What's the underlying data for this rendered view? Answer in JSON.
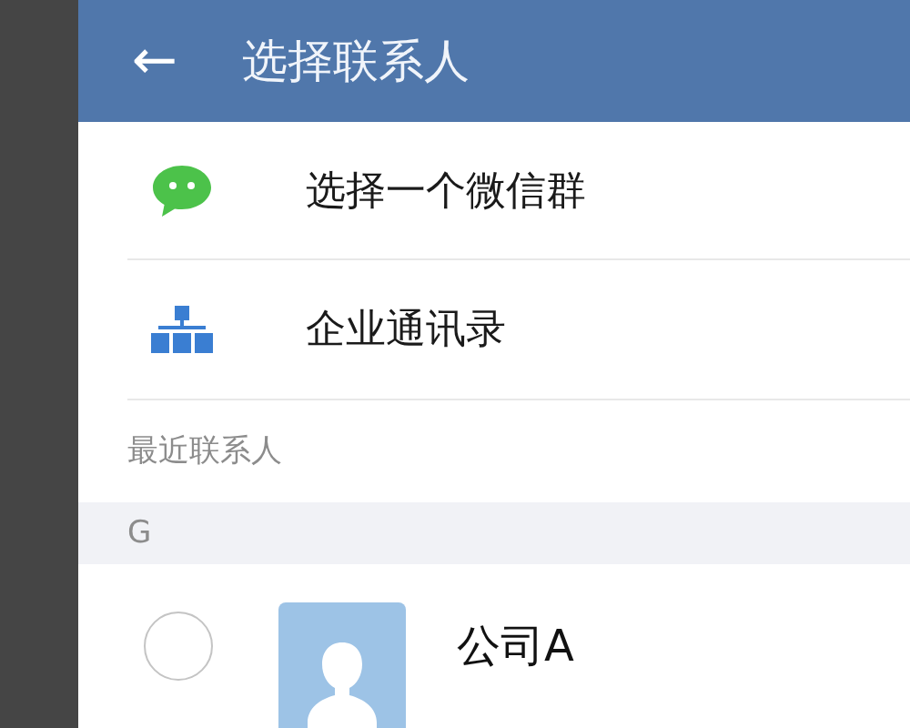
{
  "header": {
    "back_icon": "←",
    "title": "选择联系人"
  },
  "entries": [
    {
      "kind": "group",
      "label": "选择一个微信群"
    },
    {
      "kind": "directory",
      "label": "企业通讯录"
    }
  ],
  "section": {
    "title": "最近联系人"
  },
  "groups": [
    {
      "letter": "G",
      "contacts": [
        {
          "name": "公司A",
          "selected": false
        }
      ]
    }
  ]
}
